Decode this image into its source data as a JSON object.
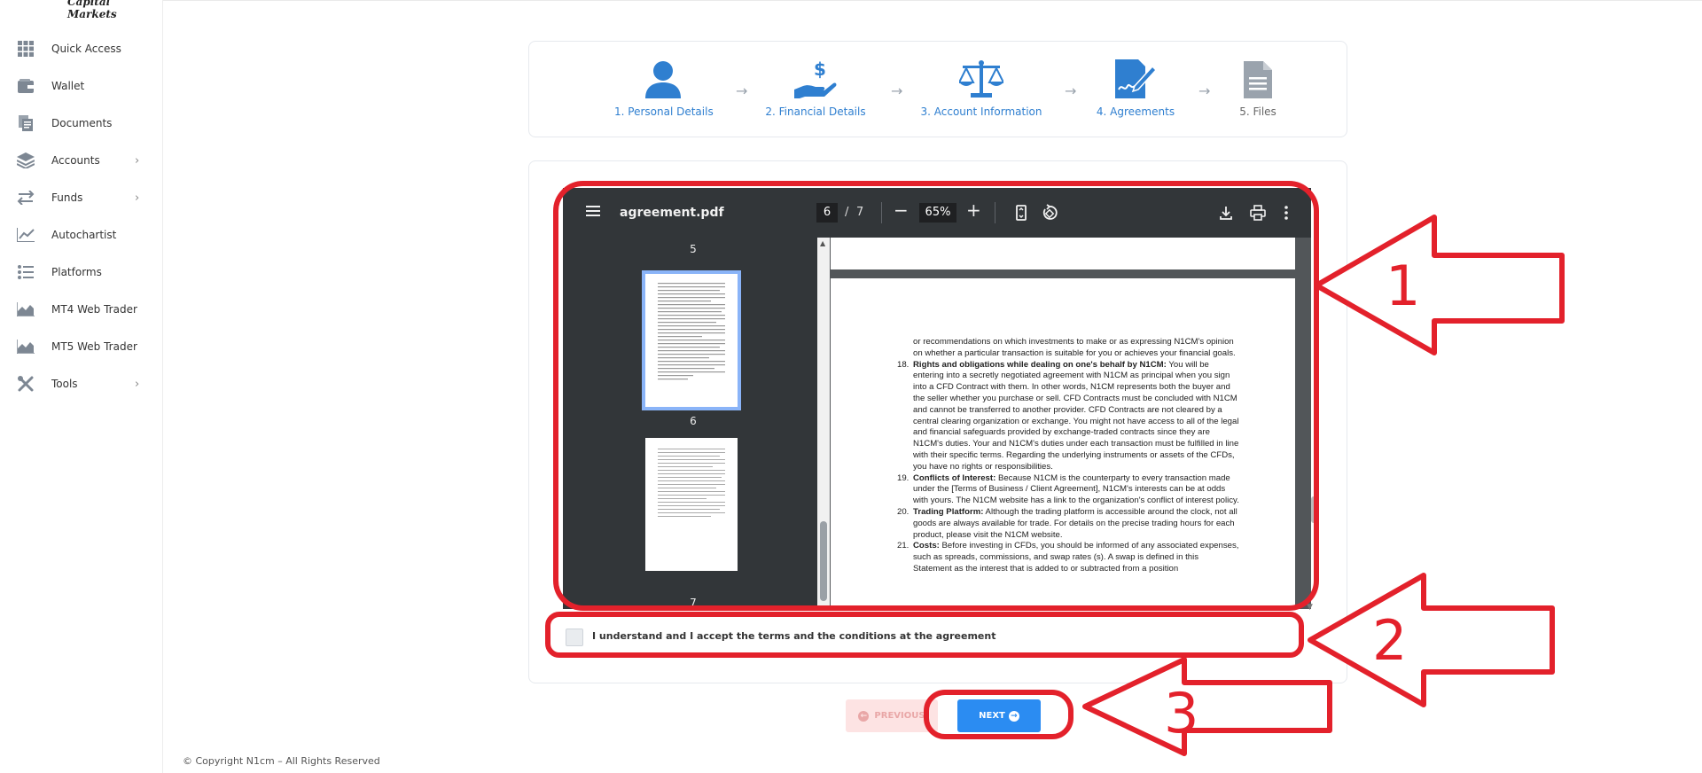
{
  "app": {
    "logo_text": "Capital Markets"
  },
  "sidebar": {
    "items": [
      {
        "label": "Quick Access",
        "icon": "grid-icon",
        "has_chevron": false
      },
      {
        "label": "Wallet",
        "icon": "wallet-icon",
        "has_chevron": false
      },
      {
        "label": "Documents",
        "icon": "documents-icon",
        "has_chevron": false
      },
      {
        "label": "Accounts",
        "icon": "layers-icon",
        "has_chevron": true
      },
      {
        "label": "Funds",
        "icon": "transfer-icon",
        "has_chevron": true
      },
      {
        "label": "Autochartist",
        "icon": "line-chart-icon",
        "has_chevron": false
      },
      {
        "label": "Platforms",
        "icon": "list-icon",
        "has_chevron": false
      },
      {
        "label": "MT4 Web Trader",
        "icon": "area-chart-icon",
        "has_chevron": false
      },
      {
        "label": "MT5 Web Trader",
        "icon": "area-chart-icon",
        "has_chevron": false
      },
      {
        "label": "Tools",
        "icon": "tools-icon",
        "has_chevron": true
      }
    ]
  },
  "stepper": {
    "steps": [
      {
        "label": "1. Personal Details",
        "icon": "user-icon",
        "active": true
      },
      {
        "label": "2. Financial Details",
        "icon": "money-hand-icon",
        "active": true
      },
      {
        "label": "3. Account Information",
        "icon": "scale-icon",
        "active": true
      },
      {
        "label": "4. Agreements",
        "icon": "signed-document-icon",
        "active": true
      },
      {
        "label": "5. Files",
        "icon": "file-icon",
        "active": false
      }
    ]
  },
  "pdf_viewer": {
    "file_name": "agreement.pdf",
    "current_page": "6",
    "separator": "/",
    "total_pages": "7",
    "zoom": "65%",
    "thumb_labels": [
      "5",
      "6",
      "7"
    ],
    "page_text": {
      "intro": "or recommendations on which investments to make or as expressing N1CM's opinion on whether a particular transaction is suitable for you or achieves your financial goals.",
      "items": [
        {
          "num": "18.",
          "title": "Rights and obligations while dealing on one's behalf by N1CM:",
          "body": " You will be entering into a secretly negotiated agreement with N1CM as principal when you sign into a CFD Contract with them. In other words, N1CM represents both the buyer and the seller whether you purchase or sell. CFD Contracts must be concluded with N1CM and cannot be transferred to another provider. CFD Contracts are not cleared by a central clearing organization or exchange. You might not have access to all of the legal and financial safeguards provided by exchange-traded contracts since they are N1CM's duties. Your and N1CM's duties under each transaction must be fulfilled in line with their specific terms. Regarding the underlying instruments or assets of the CFDs, you have no rights or responsibilities."
        },
        {
          "num": "19.",
          "title": "Conflicts of Interest:",
          "body": " Because N1CM is the counterparty to every transaction made under the [Terms of Business / Client Agreement], N1CM's interests can be at odds with yours. The N1CM website has a link to the organization's conflict of interest policy."
        },
        {
          "num": "20.",
          "title": "Trading Platform:",
          "body": " Although the trading platform is accessible around the clock, not all goods are always available for trade. For details on the precise trading hours for each product, please visit the N1CM website."
        },
        {
          "num": "21.",
          "title": "Costs:",
          "body": " Before investing in CFDs, you should be informed of any associated expenses, such as spreads, commissions, and swap rates (s). A swap is defined in this Statement as the interest that is added to or subtracted from a position"
        }
      ]
    }
  },
  "agreement": {
    "checkbox_label": "I understand and I accept the terms and the conditions at the agreement",
    "checked": false
  },
  "buttons": {
    "previous_label": "PREVIOUS",
    "next_label": "NEXT"
  },
  "annotations": {
    "labels": [
      "1",
      "2",
      "3"
    ],
    "color": "#e3212b"
  },
  "footer": {
    "copyright": "© Copyright N1cm – All Rights Reserved"
  },
  "colors": {
    "accent": "#2b8cf2",
    "step_blue": "#2f7fd0",
    "annotation_red": "#e3212b"
  }
}
